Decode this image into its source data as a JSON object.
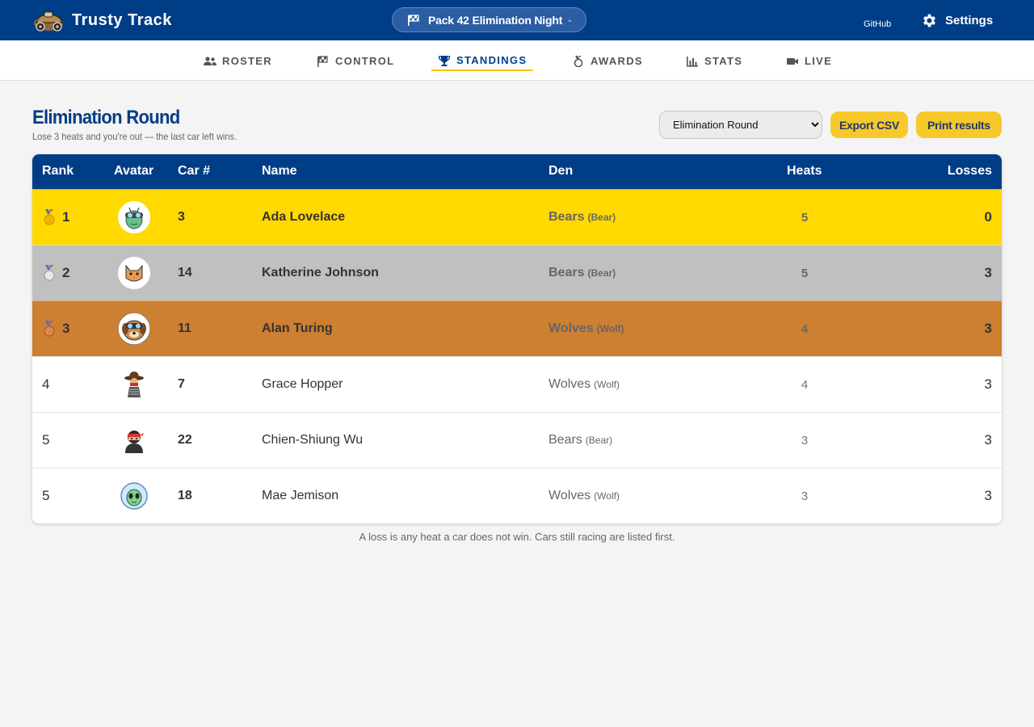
{
  "app": {
    "name": "Trusty Track"
  },
  "event": {
    "name": "Pack 42 Elimination Night"
  },
  "header": {
    "github_label": "GitHub",
    "settings_label": "Settings"
  },
  "nav": {
    "items": [
      {
        "label": "ROSTER",
        "icon": "people-icon"
      },
      {
        "label": "CONTROL",
        "icon": "checkered-flag-icon"
      },
      {
        "label": "STANDINGS",
        "icon": "trophy-icon",
        "active": true
      },
      {
        "label": "AWARDS",
        "icon": "medal-icon"
      },
      {
        "label": "STATS",
        "icon": "bar-chart-icon"
      },
      {
        "label": "LIVE",
        "icon": "video-camera-icon"
      }
    ]
  },
  "page": {
    "title": "Elimination Round",
    "subtitle": "Lose 3 heats and you're out — the last car left wins.",
    "round_select": {
      "selected": "Elimination Round"
    },
    "export_label": "Export CSV",
    "print_label": "Print results",
    "footnote": "A loss is any heat a car does not win. Cars still racing are listed first."
  },
  "table": {
    "columns": [
      "Rank",
      "Avatar",
      "Car #",
      "Name",
      "Den",
      "Heats",
      "Losses"
    ],
    "rows": [
      {
        "rank": "1",
        "medal": "gold-medal-icon",
        "avatar": "alien-goggles-avatar",
        "car": "3",
        "name": "Ada Lovelace",
        "den": "Bears",
        "den_type": "(Bear)",
        "heats": "5",
        "losses": "0"
      },
      {
        "rank": "2",
        "medal": "silver-medal-icon",
        "avatar": "cat-avatar",
        "car": "14",
        "name": "Katherine Johnson",
        "den": "Bears",
        "den_type": "(Bear)",
        "heats": "5",
        "losses": "3"
      },
      {
        "rank": "3",
        "medal": "bronze-medal-icon",
        "avatar": "dog-goggles-avatar",
        "car": "11",
        "name": "Alan Turing",
        "den": "Wolves",
        "den_type": "(Wolf)",
        "heats": "4",
        "losses": "3"
      },
      {
        "rank": "4",
        "avatar": "cowboy-avatar",
        "car": "7",
        "name": "Grace Hopper",
        "den": "Wolves",
        "den_type": "(Wolf)",
        "heats": "4",
        "losses": "3"
      },
      {
        "rank": "5",
        "avatar": "ninja-avatar",
        "car": "22",
        "name": "Chien-Shiung Wu",
        "den": "Bears",
        "den_type": "(Bear)",
        "heats": "3",
        "losses": "3"
      },
      {
        "rank": "5",
        "avatar": "alien-helmet-avatar",
        "car": "18",
        "name": "Mae Jemison",
        "den": "Wolves",
        "den_type": "(Wolf)",
        "heats": "3",
        "losses": "3"
      }
    ]
  },
  "colors": {
    "brand": "#003d87",
    "accent": "#f7c82b",
    "gold": "#ffd900",
    "silver": "#c0c0c0",
    "bronze": "#cd7f32"
  }
}
